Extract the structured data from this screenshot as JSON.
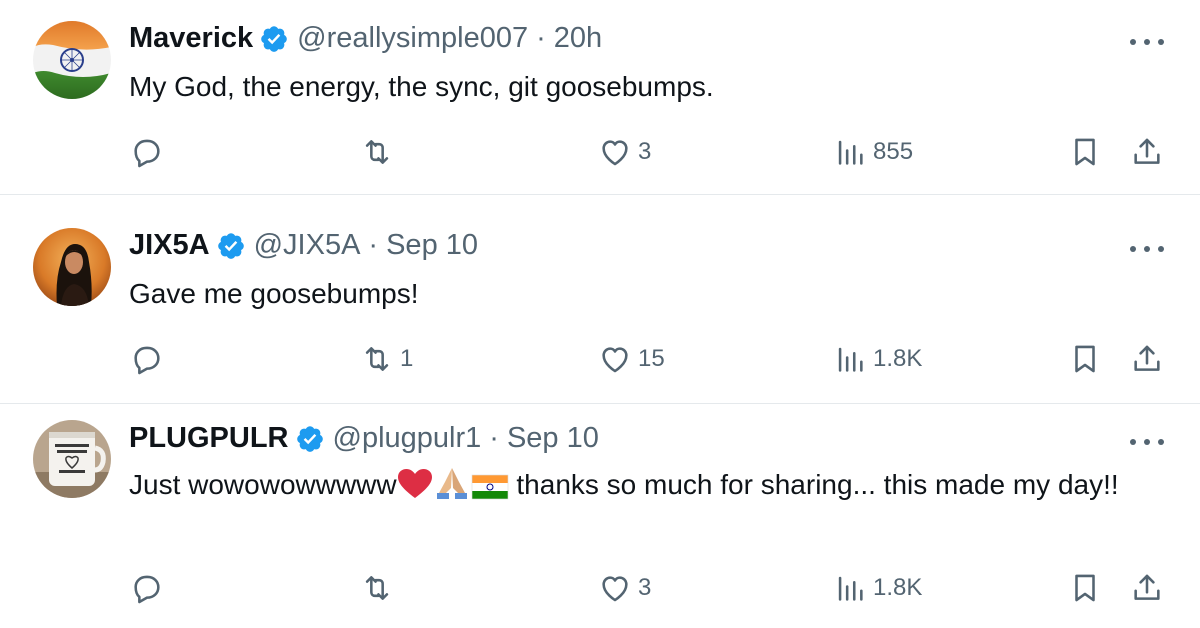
{
  "tweets": [
    {
      "name": "Maverick",
      "handle": "@reallysimple007",
      "separator": "·",
      "time": "20h",
      "text": "My God, the energy, the sync, git goosebumps.",
      "reply_count": "",
      "retweet_count": "",
      "like_count": "3",
      "view_count": "855",
      "avatar": "india-flag-avatar"
    },
    {
      "name": "JIX5A",
      "handle": "@JIX5A",
      "separator": "·",
      "time": "Sep 10",
      "text": "Gave me goosebumps!",
      "reply_count": "",
      "retweet_count": "1",
      "like_count": "15",
      "view_count": "1.8K",
      "avatar": "woman-portrait-avatar"
    },
    {
      "name": "PLUGPULR",
      "handle": "@plugpulr1",
      "separator": "·",
      "time": "Sep 10",
      "text_before": "Just wowowowwwww",
      "text_after": " thanks so much for sharing... this made my day!!",
      "emojis": [
        "red-heart",
        "folded-hands",
        "india-flag"
      ],
      "reply_count": "",
      "retweet_count": "",
      "like_count": "3",
      "view_count": "1.8K",
      "avatar": "mug-photo-avatar"
    }
  ],
  "colors": {
    "text": "#0f1419",
    "secondary": "#536471",
    "verified": "#1d9bf0",
    "divider": "#e5e9ec"
  }
}
